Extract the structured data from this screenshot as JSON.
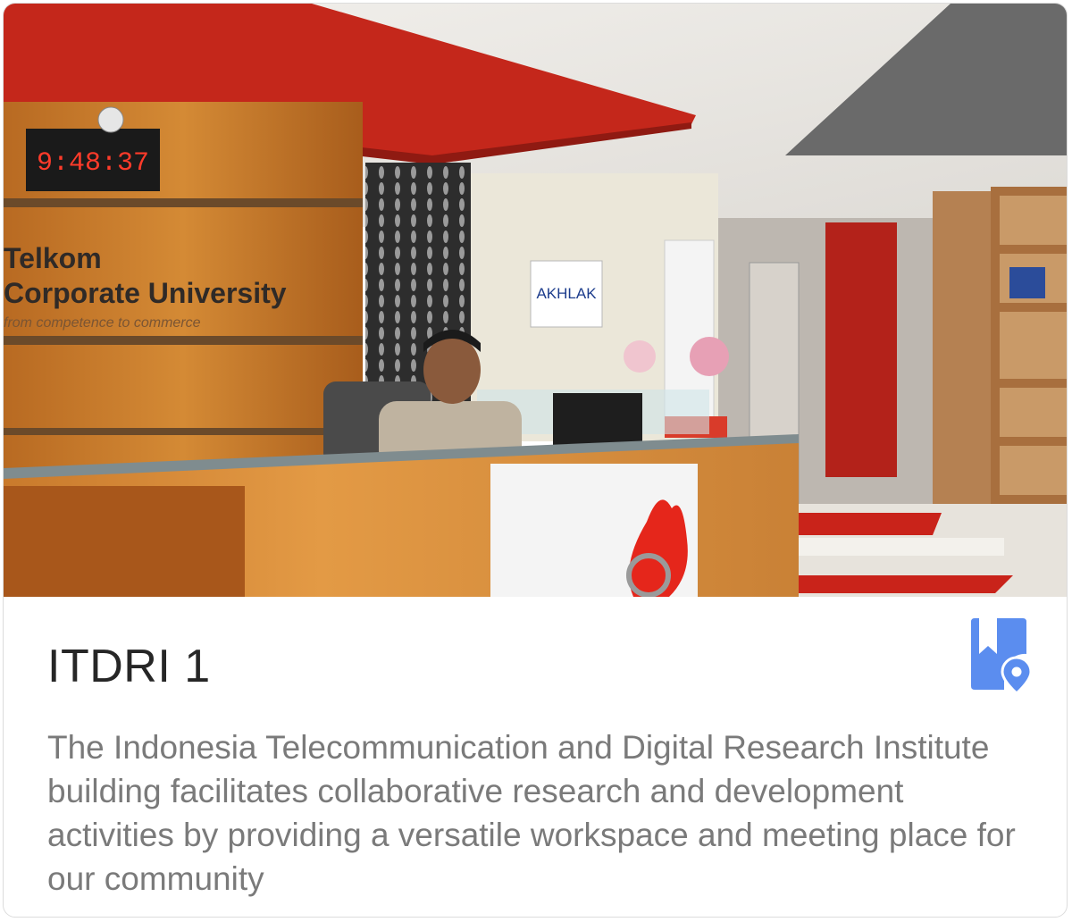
{
  "card": {
    "title": "ITDRI 1",
    "description": "The Indonesia Telecommunication and Digital Research Institute building facilitates collaborative research and development activities by providing a versatile workspace and meeting place for our community",
    "map_icon": "bookmark-location-icon",
    "accent_color": "#5b8def"
  },
  "photo": {
    "clock_text": "9:48:37",
    "wall_sign_line1": "Telkom",
    "wall_sign_line2": "Corporate University",
    "wall_sign_tagline": "from competence to commerce",
    "poster_text": "AKHLAK"
  }
}
